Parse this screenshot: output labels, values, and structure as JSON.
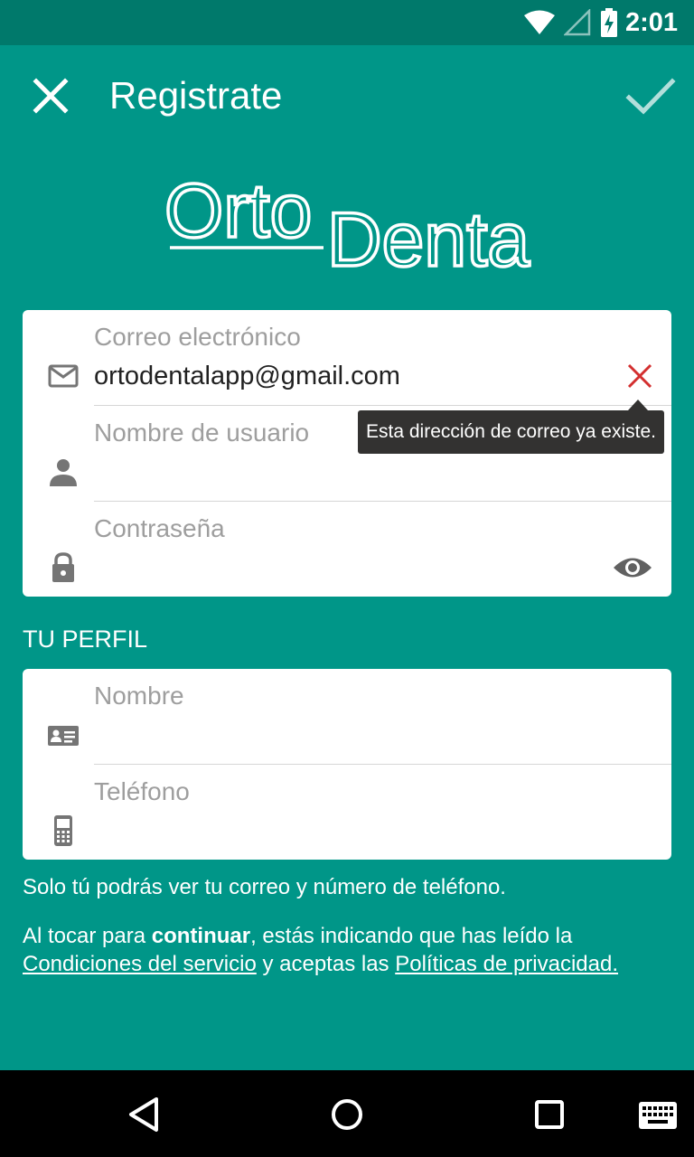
{
  "status_bar": {
    "time": "2:01",
    "icons": [
      "wifi-icon",
      "signal-icon",
      "battery-charging-icon"
    ]
  },
  "app_bar": {
    "title": "Registrate",
    "close_icon": "close-icon",
    "confirm_icon": "check-icon"
  },
  "logo": {
    "text_line1": "Orto",
    "text_line2": "Dental"
  },
  "account": {
    "email": {
      "label": "Correo electrónico",
      "value": "ortodentalapp@gmail.com",
      "icon": "mail-icon",
      "error_icon": "clear-error-icon"
    },
    "error_tooltip": "Esta dirección de correo ya existe.",
    "username": {
      "label": "Nombre de usuario",
      "value": "",
      "icon": "person-icon"
    },
    "password": {
      "label": "Contraseña",
      "value": "",
      "icon": "lock-icon",
      "toggle_icon": "eye-icon"
    }
  },
  "profile": {
    "section_title": "TU PERFIL",
    "name": {
      "label": "Nombre",
      "value": "",
      "icon": "id-card-icon"
    },
    "phone": {
      "label": "Teléfono",
      "value": "",
      "icon": "phone-icon"
    }
  },
  "privacy_note": "Solo tú podrás ver tu correo y número de teléfono.",
  "legal": {
    "prefix": "Al tocar para ",
    "bold": "continuar",
    "middle": ", estás indicando que has leído la",
    "terms_link": "Condiciones del servicio",
    "connector": " y aceptas las ",
    "privacy_link": "Políticas de privacidad."
  },
  "nav_bar": {
    "back": "back-icon",
    "home": "home-icon",
    "recents": "recents-icon",
    "keyboard": "keyboard-icon"
  },
  "colors": {
    "primary": "#009688",
    "primary_dark": "#00796b",
    "error": "#d32f2f",
    "accent": "#b2dfdb"
  }
}
